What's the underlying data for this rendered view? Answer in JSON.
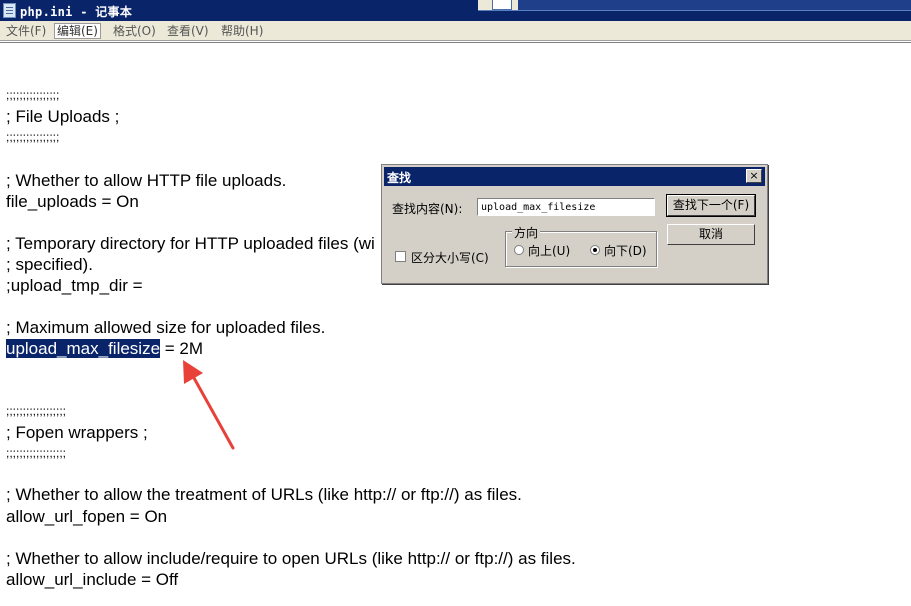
{
  "window": {
    "title": "php.ini - 记事本"
  },
  "menu": {
    "items": [
      "文件(F)",
      "编辑(E)",
      "格式(O)",
      "查看(V)",
      "帮助(H)"
    ]
  },
  "editor": {
    "lines": {
      "l1": ";;;;;;;;;;;;;;;;",
      "l2": "; File Uploads ;",
      "l3": ";;;;;;;;;;;;;;;;",
      "l4": "; Whether to allow HTTP file uploads.",
      "l5": "file_uploads = On",
      "l6": "; Temporary directory for HTTP uploaded files (wi",
      "l7": "; specified).",
      "l8": ";upload_tmp_dir =",
      "l9": "; Maximum allowed size for uploaded files.",
      "l10_highlight": "upload_max_filesize",
      "l10_rest": " = 2M",
      "l11": ";;;;;;;;;;;;;;;;;;",
      "l12": "; Fopen wrappers ;",
      "l13": ";;;;;;;;;;;;;;;;;;",
      "l14": "; Whether to allow the treatment of URLs (like http:// or ftp://) as files.",
      "l15": "allow_url_fopen = On",
      "l16": "; Whether to allow include/require to open URLs (like http:// or ftp://) as files.",
      "l17": "allow_url_include = Off"
    }
  },
  "find_dialog": {
    "title": "查找",
    "close_label": "×",
    "find_label": "查找内容(N):",
    "find_value": "upload_max_filesize",
    "find_next_label": "查找下一个(F)",
    "cancel_label": "取消",
    "direction_label": "方向",
    "up_label": "向上(U)",
    "down_label": "向下(D)",
    "match_case_label": "区分大小写(C)",
    "direction_selected": "down",
    "match_case_checked": false
  },
  "annotation": {
    "arrow_color": "#e8413a"
  }
}
